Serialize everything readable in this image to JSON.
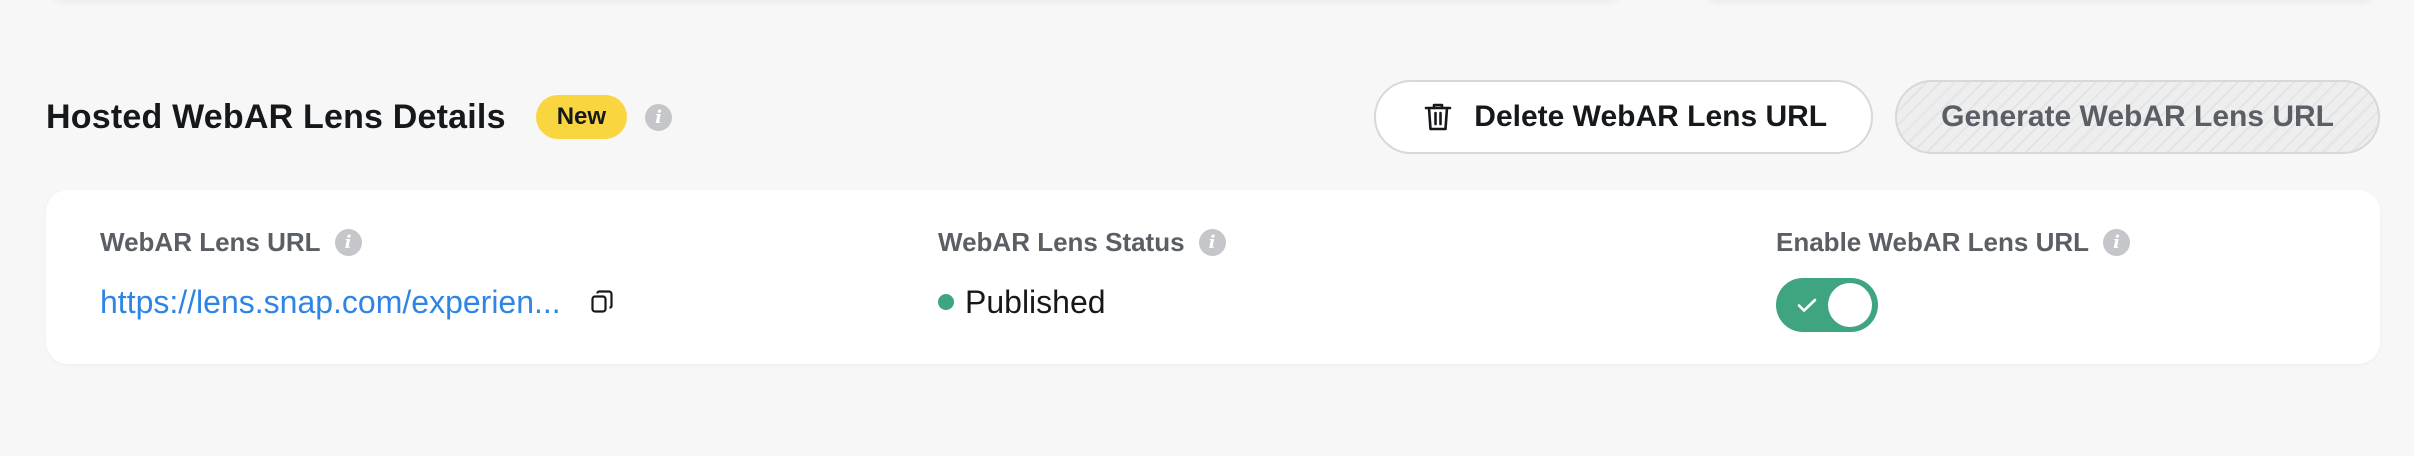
{
  "section": {
    "title": "Hosted WebAR Lens Details",
    "badge": "New",
    "info_icon": "i"
  },
  "actions": {
    "delete_label": "Delete WebAR Lens URL",
    "delete_icon": "trash-icon",
    "generate_label": "Generate WebAR Lens URL",
    "generate_disabled": true
  },
  "fields": {
    "url": {
      "label": "WebAR Lens URL",
      "value": "https://lens.snap.com/experien...",
      "copy_icon": "copy-icon"
    },
    "status": {
      "label": "WebAR Lens Status",
      "value": "Published",
      "dot_color": "#3fa580"
    },
    "enable": {
      "label": "Enable WebAR Lens URL",
      "enabled": true
    }
  },
  "colors": {
    "accent_yellow": "#f9d63f",
    "link_blue": "#2e85e6",
    "success_green": "#3fa580",
    "background": "#f7f7f7"
  }
}
